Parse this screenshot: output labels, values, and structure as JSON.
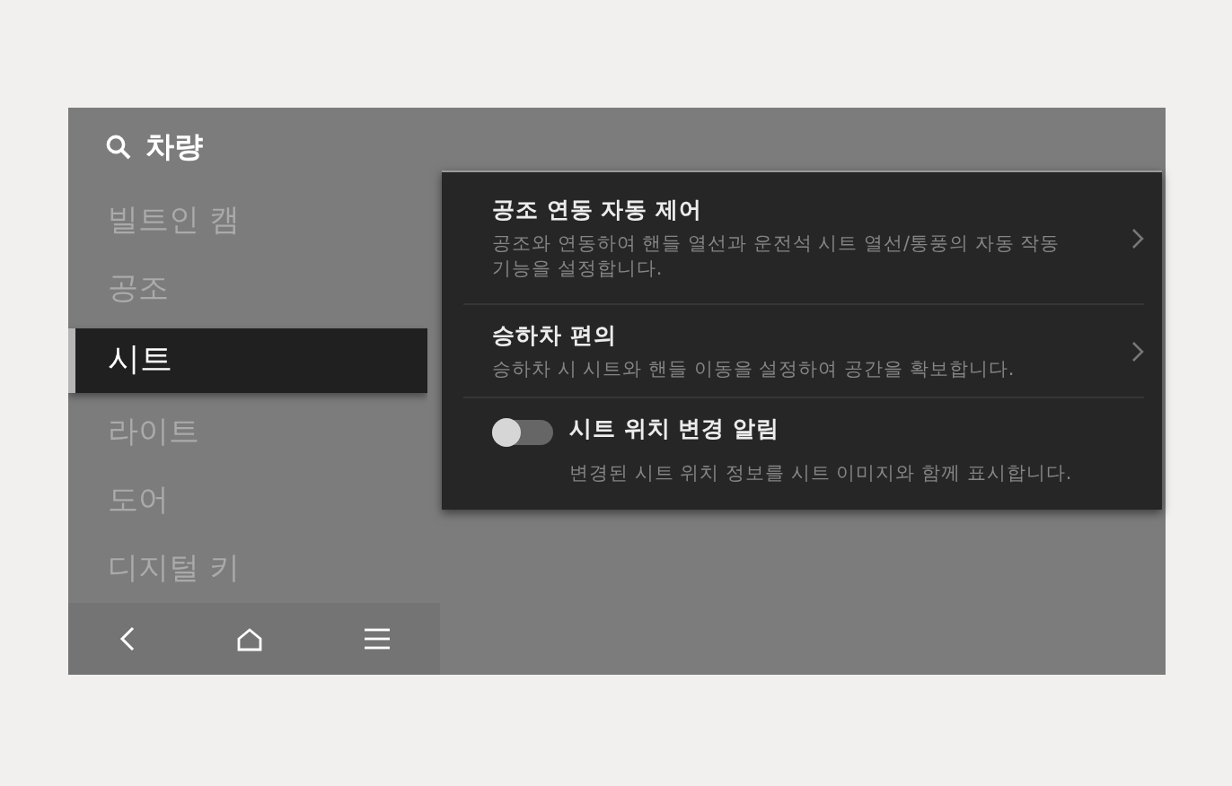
{
  "search": {
    "label": "차량"
  },
  "menu": [
    {
      "label": "빌트인 캠",
      "selected": false
    },
    {
      "label": "공조",
      "selected": false
    },
    {
      "label": "시트",
      "selected": true
    },
    {
      "label": "라이트",
      "selected": false
    },
    {
      "label": "도어",
      "selected": false
    },
    {
      "label": "디지털 키",
      "selected": false
    }
  ],
  "nav_buttons": [
    {
      "kind": "back"
    },
    {
      "kind": "home"
    },
    {
      "kind": "menu"
    }
  ],
  "settings": [
    {
      "kind": "link",
      "title": "공조 연동 자동 제어",
      "description": "공조와 연동하여 핸들 열선과 운전석 시트 열선/통풍의 자동 작동 기능을 설정합니다."
    },
    {
      "kind": "link",
      "title": "승하차 편의",
      "description": "승하차 시 시트와 핸들 이동을 설정하여 공간을 확보합니다."
    },
    {
      "kind": "toggle",
      "title": "시트 위치 변경 알림",
      "description": "변경된 시트 위치 정보를 시트 이미지와 함께 표시합니다.",
      "on": false
    }
  ]
}
